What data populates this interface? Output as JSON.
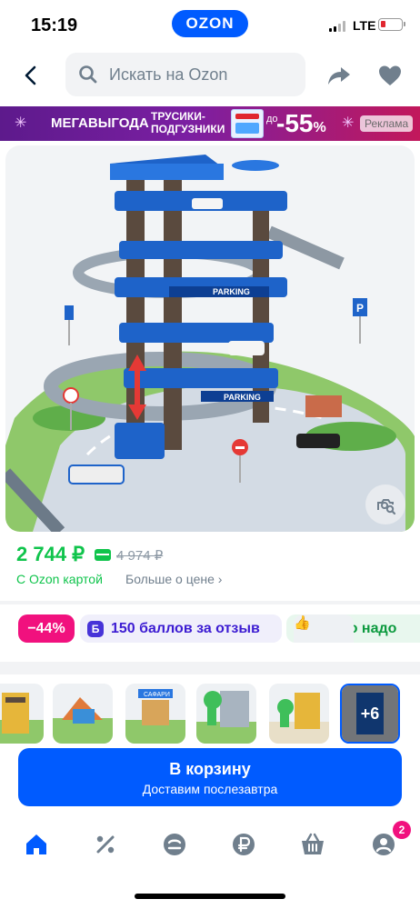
{
  "status_bar": {
    "time": "15:19",
    "center_logo": "OZON",
    "network": "LTE"
  },
  "search": {
    "placeholder": "Искать на Ozon",
    "icons": [
      "chevron-left-icon",
      "search-icon",
      "share-icon",
      "heart-icon"
    ]
  },
  "ad_banner": {
    "title": "МЕГАВЫГОДА",
    "product_line1": "ТРУСИКИ-",
    "product_line2": "ПОДГУЗНИКИ",
    "pack_brand": "HUGGIES",
    "discount_prefix": "до",
    "discount_value": "-55",
    "discount_unit": "%",
    "label": "Реклама",
    "colors": {
      "start": "#5d1a8c",
      "end": "#c2185b"
    }
  },
  "product": {
    "image_description_icon": "visual-search-icon",
    "price": "2 744 ₽",
    "old_price": "4 974 ₽",
    "ozon_card_link": "С Ozon картой",
    "more_price_link": "Больше о цене"
  },
  "badges": {
    "discount": "−44%",
    "points_letter": "Б",
    "points": "150 баллов за отзыв",
    "good_price": "Цена что надо"
  },
  "thumbnails": {
    "count_shown": 7,
    "more_label": "+6"
  },
  "cart": {
    "label": "В корзину",
    "sublabel": "Доставим послезавтра"
  },
  "tabbar": {
    "items": [
      "home-icon",
      "percent-icon",
      "catalog-icon",
      "ruble-icon",
      "basket-icon",
      "profile-icon"
    ],
    "cart_count": "2",
    "active": "home-icon",
    "accent": "#005bff"
  }
}
